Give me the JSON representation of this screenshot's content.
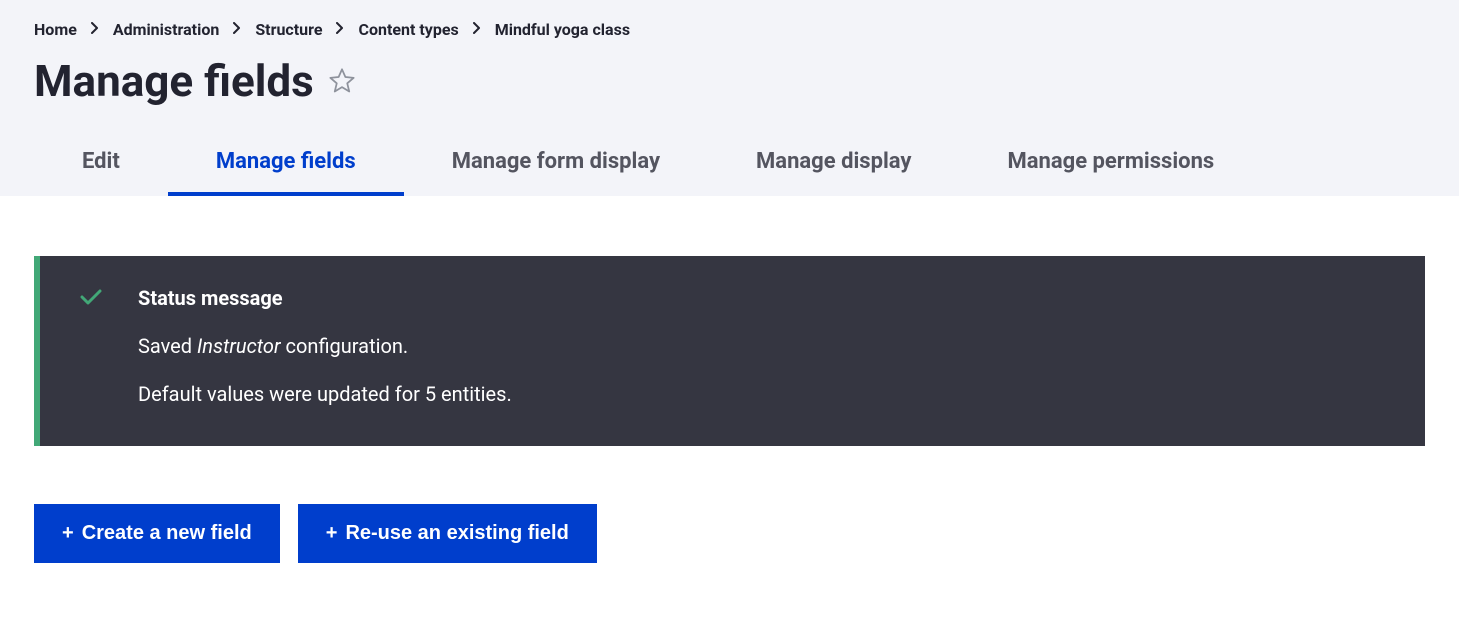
{
  "breadcrumb": {
    "items": [
      {
        "label": "Home"
      },
      {
        "label": "Administration"
      },
      {
        "label": "Structure"
      },
      {
        "label": "Content types"
      },
      {
        "label": "Mindful yoga class"
      }
    ]
  },
  "page": {
    "title": "Manage fields"
  },
  "tabs": {
    "items": [
      {
        "label": "Edit",
        "active": false
      },
      {
        "label": "Manage fields",
        "active": true
      },
      {
        "label": "Manage form display",
        "active": false
      },
      {
        "label": "Manage display",
        "active": false
      },
      {
        "label": "Manage permissions",
        "active": false
      }
    ]
  },
  "status": {
    "title": "Status message",
    "line1_prefix": "Saved ",
    "line1_em": "Instructor",
    "line1_suffix": " configuration.",
    "line2": "Default values were updated for 5 entities."
  },
  "actions": {
    "create_label": "Create a new field",
    "reuse_label": "Re-use an existing field",
    "plus": "+"
  }
}
